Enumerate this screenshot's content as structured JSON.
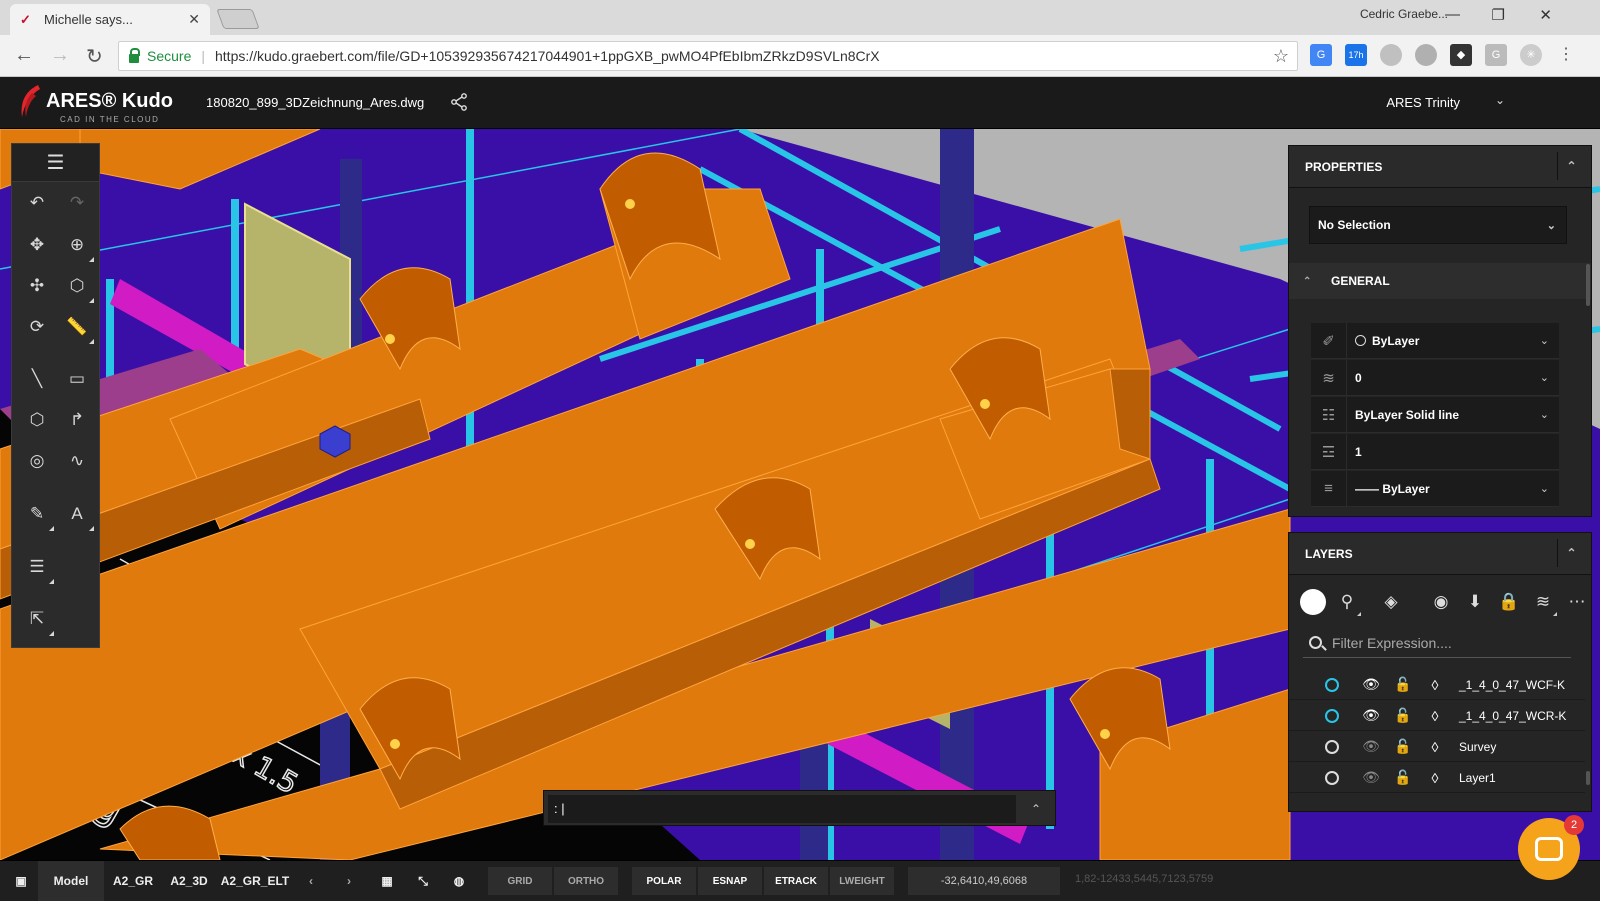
{
  "browser": {
    "tab_title": "Michelle says...",
    "profile_name": "Cedric Graebe...",
    "secure_label": "Secure",
    "url": "https://kudo.graebert.com/file/GD+105392935674217044901+1ppGXB_pwMO4PfEbIbmZRkzD9SVLn8CrX",
    "ext_badge": "17h"
  },
  "app": {
    "brand": "ARES® Kudo",
    "tagline": "CAD IN THE CLOUD",
    "filename": "180820_899_3DZeichnung_Ares.dwg",
    "user_menu": "ARES Trinity"
  },
  "properties": {
    "title": "PROPERTIES",
    "selection": "No Selection",
    "section": "GENERAL",
    "rows": [
      {
        "icon": "color-icon",
        "value": "ByLayer"
      },
      {
        "icon": "layer-stack-icon",
        "value": "0"
      },
      {
        "icon": "linetype-icon",
        "value": "ByLayer Solid line"
      },
      {
        "icon": "linescale-icon",
        "value": "1"
      },
      {
        "icon": "lineweight-icon",
        "value": "—— ByLayer"
      }
    ]
  },
  "layers": {
    "title": "LAYERS",
    "filter_placeholder": "Filter Expression....",
    "items": [
      {
        "name": "_1_4_0_47_WCF-K",
        "current_color": "#29c5e6",
        "visible": true
      },
      {
        "name": "_1_4_0_47_WCR-K",
        "current_color": "#29c5e6",
        "visible": true
      },
      {
        "name": "Survey",
        "current_color": "#dddddd",
        "visible": false
      },
      {
        "name": "Layer1",
        "current_color": "#dddddd",
        "visible": false
      }
    ]
  },
  "command": {
    "prompt": ": |"
  },
  "statusbar": {
    "model_tab": "Model",
    "layout_tabs": [
      "A2_GR",
      "A2_3D",
      "A2_GR_ELT"
    ],
    "toggles": [
      "GRID",
      "ORTHO",
      "POLAR",
      "ESNAP",
      "ETRACK",
      "LWEIGHT"
    ],
    "coords": "-32,6410,49,6068",
    "coords_secondary": "1,82-12433,5445,7123,5759"
  },
  "chat": {
    "badge_count": "2"
  },
  "colors": {
    "duct_orange": "#e07a0c",
    "frame_cyan": "#29c5e6",
    "background_purple": "#3a0fa8",
    "beam_magenta": "#d11bc4",
    "panel_yellow": "#b6b46a"
  }
}
